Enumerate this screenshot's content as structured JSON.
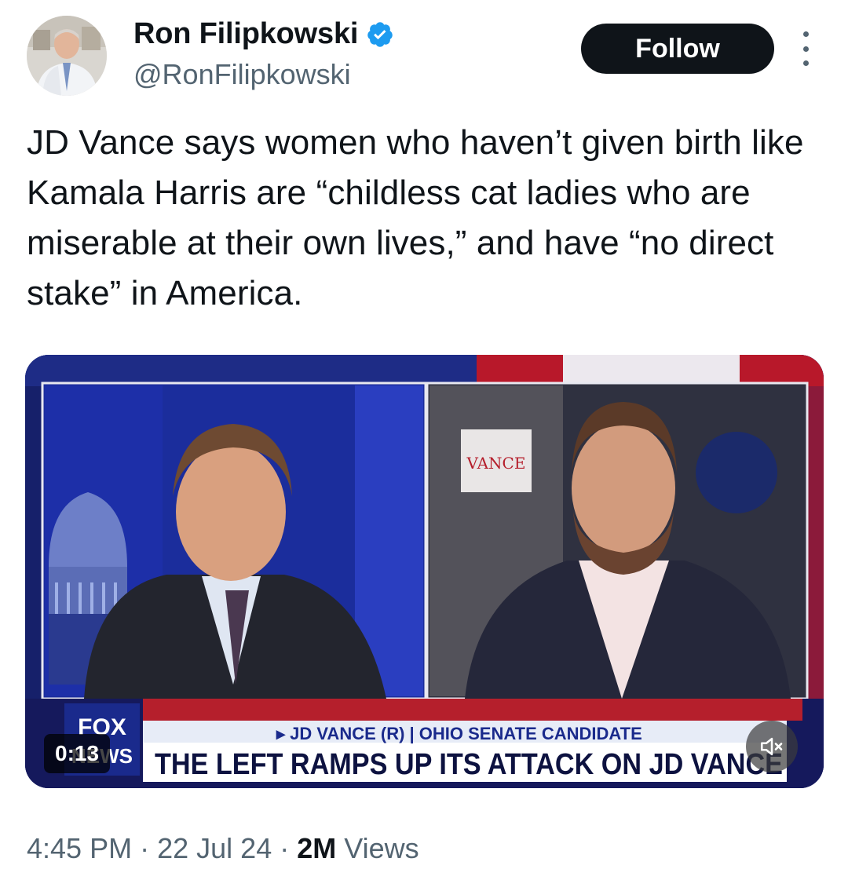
{
  "author": {
    "name": "Ron Filipkowski",
    "handle": "@RonFilipkowski",
    "verified": true,
    "verified_color": "#1d9bf0"
  },
  "actions": {
    "follow_label": "Follow",
    "more_icon": "more-vertical-icon"
  },
  "tweet": {
    "text": "JD Vance says women who haven’t given birth like Kamala Harris are “childless cat ladies who are miserable at their own lives,” and have “no direct stake” in America."
  },
  "video": {
    "duration": "0:13",
    "chyron_top": "▸ JD VANCE (R) | OHIO SENATE CANDIDATE",
    "chyron_main": "THE LEFT RAMPS UP ITS ATTACK ON JD VANCE",
    "logo_line1": "FOX",
    "logo_line2": "NEWS",
    "sign_text": "VANCE",
    "mute_icon": "speaker-muted-icon"
  },
  "meta": {
    "time": "4:45 PM",
    "separator": "·",
    "date": "22 Jul 24",
    "views_count": "2M",
    "views_label": "Views"
  },
  "colors": {
    "text": "#0f1419",
    "secondary": "#536471",
    "button_bg": "#0f1419",
    "fox_blue": "#1a2a8c",
    "fox_red": "#c0182a"
  }
}
